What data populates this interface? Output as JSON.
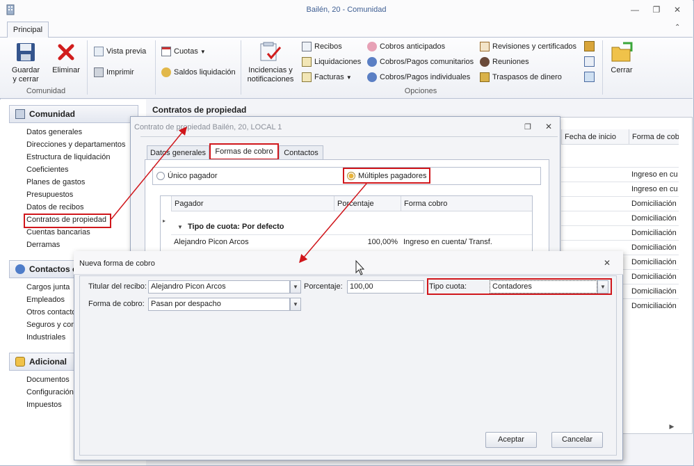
{
  "window": {
    "title": "Bailén, 20 - Comunidad"
  },
  "tabs": {
    "principal": "Principal"
  },
  "ribbon": {
    "guardar": "Guardar\ny cerrar",
    "eliminar": "Eliminar",
    "group_comunidad": "Comunidad",
    "vista_previa": "Vista previa",
    "imprimir": "Imprimir",
    "cuotas": "Cuotas",
    "saldos": "Saldos liquidación",
    "incidencias": "Incidencias y\nnotificaciones",
    "recibos": "Recibos",
    "liquidaciones": "Liquidaciones",
    "facturas": "Facturas",
    "cobros_anticipados": "Cobros anticipados",
    "cobros_comunitarios": "Cobros/Pagos comunitarios",
    "cobros_individuales": "Cobros/Pagos individuales",
    "revisiones": "Revisiones y certificados",
    "reuniones": "Reuniones",
    "traspasos": "Traspasos de dinero",
    "group_opciones": "Opciones",
    "cerrar": "Cerrar"
  },
  "nav": {
    "comunidad_header": "Comunidad",
    "comunidad_items": [
      "Datos generales",
      "Direcciones y departamentos",
      "Estructura de liquidación",
      "Coeficientes",
      "Planes de gastos",
      "Presupuestos",
      "Datos de recibos",
      "Contratos de propiedad",
      "Cuentas bancarias",
      "Derramas"
    ],
    "contactos_header": "Contactos e",
    "contactos_items": [
      "Cargos junta",
      "Empleados",
      "Otros contactos",
      "Seguros y con",
      "Industriales"
    ],
    "adicional_header": "Adicional",
    "adicional_items": [
      "Documentos",
      "Configuración",
      "Impuestos"
    ]
  },
  "main": {
    "title": "Contratos de propiedad",
    "col_fecha": "Fecha de inicio",
    "col_forma": "Forma de cob",
    "forma_values": [
      "Ingreso en cu",
      "Ingreso en cu",
      "Domiciliación",
      "Domiciliación",
      "Domiciliación",
      "Domiciliación",
      "Domiciliación",
      "Domiciliación",
      "Domiciliación",
      "Domiciliación"
    ]
  },
  "dialog1": {
    "title": "Contrato de propiedad Bailén, 20, LOCAL 1",
    "tab_datos": "Datos generales",
    "tab_formas": "Formas de cobro",
    "tab_contactos": "Contactos",
    "radio_unico": "Único pagador",
    "radio_multiples": "Múltiples pagadores",
    "col_pagador": "Pagador",
    "col_porcentaje": "Porcentaje",
    "col_forma": "Forma cobro",
    "group_row": "Tipo de cuota: Por defecto",
    "row_pagador": "Alejandro Picon Arcos",
    "row_porcentaje": "100,00%",
    "row_forma": "Ingreso en cuenta/ Transf."
  },
  "dialog2": {
    "title": "Nueva forma de cobro",
    "label_titular": "Titular del recibo:",
    "value_titular": "Alejandro Picon Arcos",
    "label_porcentaje": "Porcentaje:",
    "value_porcentaje": "100,00",
    "label_tipo": "Tipo cuota:",
    "value_tipo": "Contadores",
    "label_forma": "Forma de cobro:",
    "value_forma": "Pasan por despacho",
    "btn_aceptar": "Aceptar",
    "btn_cancelar": "Cancelar"
  },
  "colors": {
    "highlight": "#d0161b",
    "title_text": "#3f5f93"
  }
}
